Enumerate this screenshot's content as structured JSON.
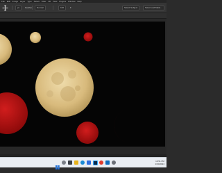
{
  "menubar": {
    "items": [
      "File",
      "Edit",
      "Image",
      "Layer",
      "Type",
      "Select",
      "Filter",
      "3D",
      "View",
      "Plugins",
      "Window",
      "Help"
    ]
  },
  "options_bar": {
    "tool_icon": "move-icon",
    "mode_value": "px",
    "feather_label": "Feather",
    "opacity_value": "100",
    "style_value": "Normal",
    "select_subject_label": "Select Subject",
    "select_mask_label": "Select and Mask..."
  },
  "canvas": {
    "background_color": "#050505",
    "moon_color": "#e4c989",
    "red_color": "#b81212"
  },
  "taskbar": {
    "icons": [
      "start-icon",
      "search-icon",
      "task-view-icon",
      "file-explorer-icon",
      "edge-icon",
      "store-icon",
      "photoshop-icon",
      "chrome-icon",
      "mail-icon",
      "settings-icon"
    ],
    "time": "10:51 PM",
    "date": "1/30/2024"
  }
}
